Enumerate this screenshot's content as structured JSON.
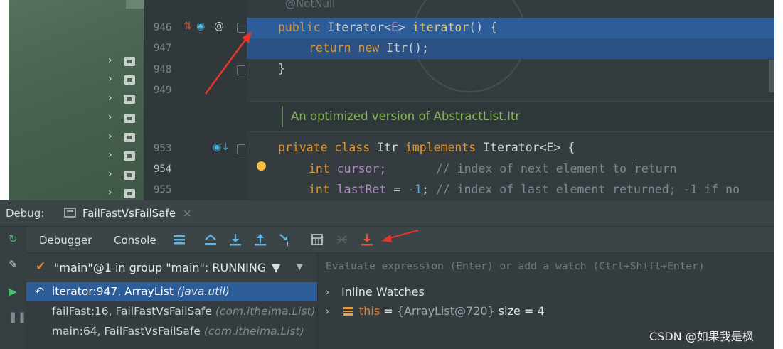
{
  "editor": {
    "top_annotation": "@NotNull",
    "lines": [
      {
        "num": "946",
        "tokens": [
          "public",
          "Iterator",
          "<",
          "E",
          ">",
          "iterator",
          "() {"
        ]
      },
      {
        "num": "947",
        "tokens": [
          "return",
          "new",
          "Itr();"
        ]
      },
      {
        "num": "948",
        "tokens": [
          "}"
        ]
      },
      {
        "num": "949",
        "tokens": []
      },
      {
        "num": "953",
        "tokens": [
          "private",
          "class",
          "Itr",
          "implements",
          "Iterator<E> {"
        ]
      },
      {
        "num": "954",
        "tokens": [
          "int",
          "cursor;",
          "// index of next element to ",
          "return"
        ]
      },
      {
        "num": "955",
        "tokens": [
          "int",
          "lastRet",
          " = ",
          "-1",
          "; ",
          "// index of last element returned; -1 if no"
        ]
      }
    ],
    "doc_note": "An optimized version of AbstractList.Itr"
  },
  "debug": {
    "label": "Debug:",
    "session_tab": "FailFastVsFailSafe",
    "tabs": {
      "debugger": "Debugger",
      "console": "Console"
    },
    "thread": "\"main\"@1 in group \"main\": RUNNING",
    "watch_placeholder": "Evaluate expression (Enter) or add a watch (Ctrl+Shift+Enter)",
    "frames": [
      {
        "method": "iterator:947, ArrayList",
        "pkg": "(java.util)"
      },
      {
        "method": "failFast:16, FailFastVsFailSafe",
        "pkg": "(com.itheima.List)"
      },
      {
        "method": "main:64, FailFastVsFailSafe",
        "pkg": "(com.itheima.List)"
      }
    ],
    "vars": {
      "inline_watches": "Inline Watches",
      "this_name": "this",
      "this_eq": " = ",
      "this_val": "{ArrayList@720}",
      "this_size": " size = 4"
    }
  },
  "watermark": "CSDN @如果我是枫",
  "colors": {
    "selection": "#2d5d98",
    "keyword": "#e0952f",
    "annotation_red": "#e8342c"
  }
}
